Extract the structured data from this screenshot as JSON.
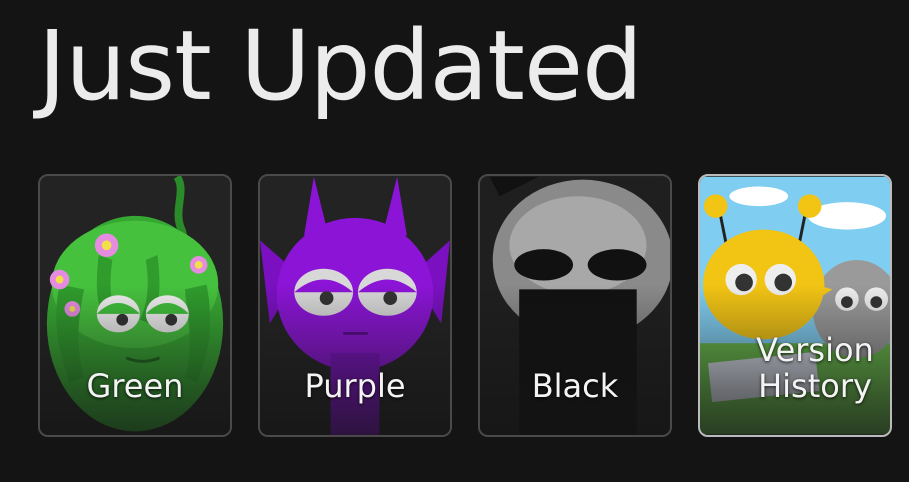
{
  "section": {
    "title": "Just Updated"
  },
  "cards": [
    {
      "label": "Green",
      "theme_color": "#3fbf3a"
    },
    {
      "label": "Purple",
      "theme_color": "#8b14d6"
    },
    {
      "label": "Black",
      "theme_color": "#111111"
    },
    {
      "label": "Version History",
      "theme_color": "#f2c414"
    }
  ]
}
